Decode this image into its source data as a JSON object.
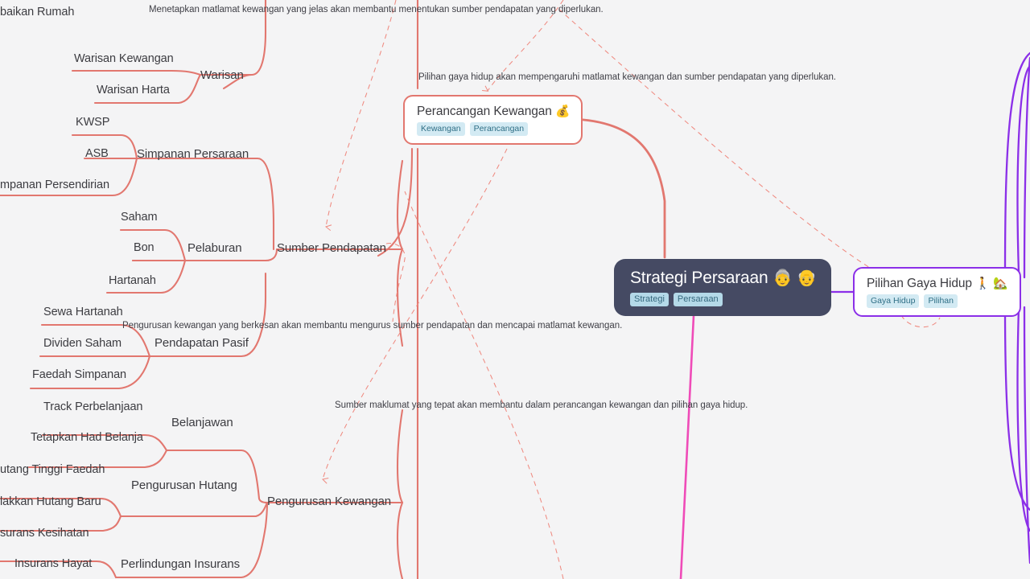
{
  "canvas": {
    "background": "#f4f4f5",
    "branch_color": "#e2776f",
    "relationship_color": "#ef8a80",
    "central_color": "#454a63",
    "lifestyle_color": "#8b2fe8",
    "magenta_color": "#ef4bb8",
    "tag_bg": "#d3eaf3",
    "tag_fg": "#2f6f86"
  },
  "central_node": {
    "title": "Strategi Persaraan",
    "emoji": "👵 👴",
    "tags": [
      "Strategi",
      "Persaraan"
    ]
  },
  "cards": [
    {
      "id": "perancangan-kewangan",
      "title": "Perancangan Kewangan",
      "emoji": "💰",
      "tags": [
        "Kewangan",
        "Perancangan"
      ],
      "accent": "#e2776f"
    },
    {
      "id": "pilihan-gaya-hidup",
      "title": "Pilihan Gaya Hidup",
      "emoji": "🚶 🏡",
      "tags": [
        "Gaya Hidup",
        "Pilihan"
      ],
      "accent": "#8b2fe8"
    }
  ],
  "branches": [
    {
      "id": "sumber-pendapatan",
      "label": "Sumber Pendapatan"
    },
    {
      "id": "pengurusan-kewangan",
      "label": "Pengurusan Kewangan"
    }
  ],
  "sub_branches": [
    {
      "id": "warisan",
      "label": "Warisan"
    },
    {
      "id": "simpanan-persaraan",
      "label": "Simpanan Persaraan"
    },
    {
      "id": "pelaburan",
      "label": "Pelaburan"
    },
    {
      "id": "pendapatan-pasif",
      "label": "Pendapatan Pasif"
    },
    {
      "id": "belanjawan",
      "label": "Belanjawan"
    },
    {
      "id": "pengurusan-hutang",
      "label": "Pengurusan Hutang"
    },
    {
      "id": "perlindungan-insurans",
      "label": "Perlindungan Insurans"
    }
  ],
  "leaves": [
    {
      "id": "baikan-rumah",
      "label": "baikan Rumah"
    },
    {
      "id": "warisan-kewangan",
      "label": "Warisan Kewangan"
    },
    {
      "id": "warisan-harta",
      "label": "Warisan Harta"
    },
    {
      "id": "kwsp",
      "label": "KWSP"
    },
    {
      "id": "asb",
      "label": "ASB"
    },
    {
      "id": "simpanan-persendirian",
      "label": "mpanan Persendirian"
    },
    {
      "id": "saham",
      "label": "Saham"
    },
    {
      "id": "bon",
      "label": "Bon"
    },
    {
      "id": "hartanah",
      "label": "Hartanah"
    },
    {
      "id": "sewa-hartanah",
      "label": "Sewa Hartanah"
    },
    {
      "id": "dividen-saham",
      "label": "Dividen Saham"
    },
    {
      "id": "faedah-simpanan",
      "label": "Faedah Simpanan"
    },
    {
      "id": "track-perbelanjaan",
      "label": "Track Perbelanjaan"
    },
    {
      "id": "tetapkan-had-belanja",
      "label": "Tetapkan Had Belanja"
    },
    {
      "id": "hutang-tinggi-faedah",
      "label": "utang Tinggi Faedah"
    },
    {
      "id": "elakkan-hutang-baru",
      "label": "lakkan Hutang Baru"
    },
    {
      "id": "insurans-kesihatan",
      "label": "surans Kesihatan"
    },
    {
      "id": "insurans-hayat",
      "label": "Insurans Hayat"
    }
  ],
  "relationship_labels": [
    {
      "id": "rel-matlamat-sumber",
      "text": "Menetapkan matlamat kewangan yang jelas akan membantu menentukan sumber pendapatan yang diperlukan."
    },
    {
      "id": "rel-gaya-hidup-matlamat",
      "text": "Pilihan gaya hidup akan mempengaruhi matlamat kewangan dan sumber pendapatan yang diperlukan."
    },
    {
      "id": "rel-pengurusan-matlamat",
      "text": "Pengurusan kewangan yang berkesan akan membantu mengurus sumber pendapatan dan mencapai matlamat kewangan."
    },
    {
      "id": "rel-sumber-maklumat",
      "text": "Sumber maklumat yang tepat akan membantu dalam perancangan kewangan dan pilihan gaya hidup."
    }
  ]
}
